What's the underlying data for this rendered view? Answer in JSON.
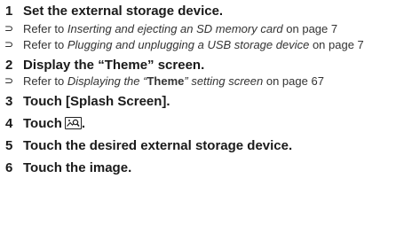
{
  "steps": [
    {
      "num": "1",
      "text": "Set the external storage device."
    },
    {
      "num": "2",
      "text": "Display the “Theme” screen."
    },
    {
      "num": "3",
      "text": "Touch [Splash Screen]."
    },
    {
      "num": "4",
      "text_before": "Touch",
      "text_after": "."
    },
    {
      "num": "5",
      "text": "Touch the desired external storage device."
    },
    {
      "num": "6",
      "text": "Touch the image."
    }
  ],
  "bullets": {
    "b1": {
      "pre": "Refer to ",
      "ital": "Inserting and ejecting an SD memory card",
      "post": " on page 7"
    },
    "b2": {
      "pre": "Refer to ",
      "ital": "Plugging and unplugging a USB storage device",
      "post": " on page 7"
    },
    "b3": {
      "pre": "Refer to ",
      "ital_a": "Displaying the “",
      "bold": "Theme",
      "ital_b": "” setting screen",
      "post": " on page 67"
    }
  },
  "icons": {
    "bullet": "arrow-bullet-icon",
    "step4": "picture-search-icon"
  }
}
